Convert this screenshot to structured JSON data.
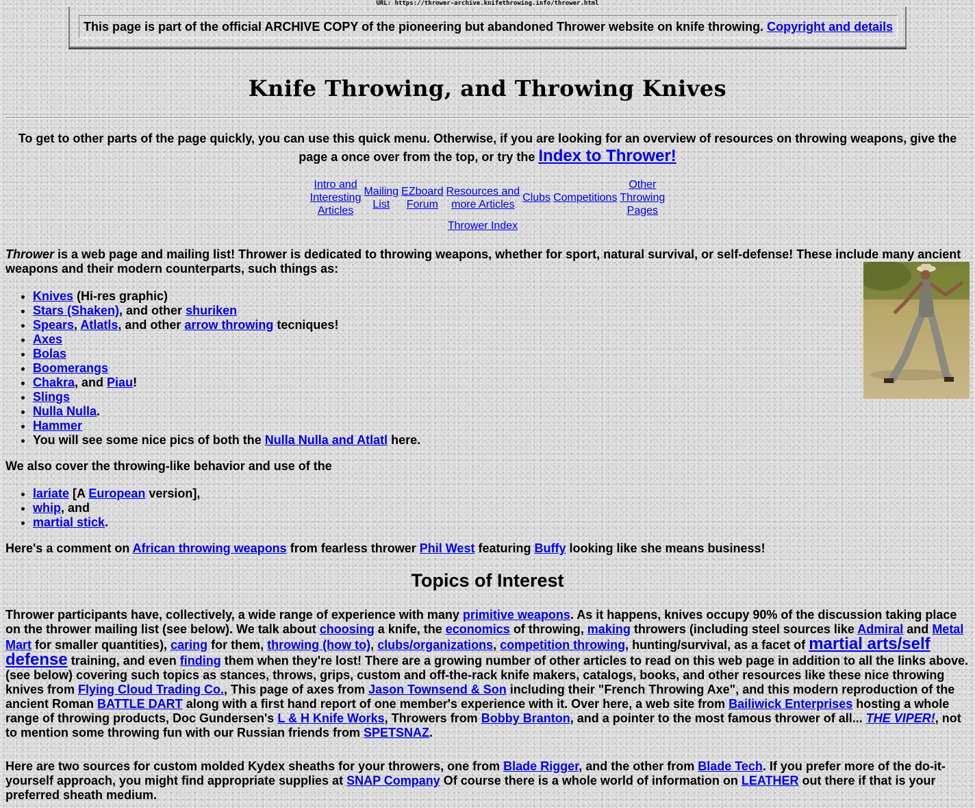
{
  "url_line": "URL: https://thrower-archive.knifethrowing.info/thrower.html",
  "archive": {
    "text": "This page is part of the official ARCHIVE COPY of the pioneering but abandoned Thrower website on knife throwing.",
    "link": "Copyright and details"
  },
  "title": "Knife Throwing, and Throwing Knives",
  "intro": {
    "text": "To get to other parts of the page quickly, you can use this quick menu. Otherwise, if you are looking for an overview of resources on throwing weapons, give the page a once over from the top, or try the",
    "index_link": "Index to Thrower!"
  },
  "quick_menu": {
    "intro_l1": "Intro and",
    "intro_l2": "Interesting",
    "intro_l3": "Articles",
    "mailing_l1": "Mailing",
    "mailing_l2": "List",
    "ezboard_l1": "EZboard",
    "ezboard_l2": "Forum",
    "resources_l1": "Resources and",
    "resources_l2": "more Articles",
    "clubs": "Clubs",
    "competitions": "Competitions",
    "other_l1": "Other",
    "other_l2": "Throwing",
    "other_l3": "Pages",
    "index": "Thrower Index"
  },
  "para1": {
    "em": "Thrower",
    "text": " is a web page and mailing list! Thrower is dedicated to throwing weapons, whether for sport, natural survival, or self-defense! These include many ancient weapons and their modern counterparts, such things as:"
  },
  "list1": {
    "knives": "Knives",
    "knives_note": " (Hi-res graphic)",
    "stars": "Stars (Shaken)",
    "and_other": ", and other ",
    "shuriken": "shuriken",
    "spears": "Spears",
    "comma": ", ",
    "atlatls": "Atlatls",
    "arrow": "arrow throwing",
    "tecniques": " tecniques!",
    "axes": "Axes",
    "bolas": "Bolas",
    "boomerangs": "Boomerangs",
    "chakra": "Chakra",
    "and": ", and ",
    "piau": "Piau",
    "bang": "!",
    "slings": "Slings",
    "nulla": "Nulla Nulla",
    "period": ".",
    "hammer": "Hammer",
    "pics_a": "You will see some nice pics of both the ",
    "pics_link": "Nulla Nulla and Atlatl",
    "pics_b": " here."
  },
  "para2": "We also cover the throwing-like behavior and use of the",
  "list2": {
    "lariate": "lariate",
    "bracket_a": " [A ",
    "european": "European",
    "bracket_b": " version],",
    "whip": "whip",
    "and": ", and",
    "martial": "martial stick",
    "period": "."
  },
  "para3": {
    "a": "Here's a comment on ",
    "african": "African throwing weapons",
    "b": " from fearless thrower ",
    "phil": "Phil West",
    "c": " featuring ",
    "buffy": "Buffy",
    "d": " looking like she means business!"
  },
  "topics_heading": "Topics of Interest",
  "para4": {
    "t1": "Thrower participants have, collectively, a wide range of experience with many ",
    "l1": "primitive weapons",
    "t2": ". As it happens, knives occupy 90% of the discussion taking place on the thrower mailing list (see below). We talk about ",
    "l2": "choosing",
    "t3": " a knife, the ",
    "l3": "economics",
    "t4": " of throwing, ",
    "l4": "making",
    "t5": " throwers (including steel sources like ",
    "l5": "Admiral",
    "t6": " and ",
    "l6": "Metal Mart",
    "t7": " for smaller quantities), ",
    "l7": "caring",
    "t8": " for them, ",
    "l8": "throwing (how to)",
    "t9": ", ",
    "l9": "clubs/organizations",
    "t10": ", ",
    "l10": "competition throwing",
    "t11": ", hunting/survival, as a facet of ",
    "l11": "martial arts/self defense",
    "t12": " training, and even ",
    "l12": "finding",
    "t13": " them when they're lost! There are a growing number of other articles to read on this web page in addition to all the links above. (see below) covering such topics as stances, throws, grips, custom and off-the-rack knife makers, catalogs, books, and other resources like these nice throwing knives from ",
    "l13": "Flying Cloud Trading Co.",
    "t14": ", This page of axes from ",
    "l14": "Jason Townsend & Son",
    "t15": " including their \"French Throwing Axe\", and this modern reproduction of the ancient Roman ",
    "l15": "BATTLE DART",
    "t16": " along with a first hand report of one member's experience with it. Over here, a web site from ",
    "l16": "Bailiwick Enterprises",
    "t17": " hosting a whole range of throwing products, Doc Gundersen's ",
    "l17": "L & H Knife Works",
    "t18": ", Throwers from ",
    "l18": "Bobby Branton",
    "t19": ", and a pointer to the most famous thrower of all... ",
    "l19": "THE VIPER!",
    "t20": ", not to mention some throwing fun with our Russian friends from ",
    "l20": "SPETSNAZ",
    "t21": "."
  },
  "para5": {
    "t1": "Here are two sources for custom molded Kydex sheaths for your throwers, one from ",
    "l1": "Blade Rigger",
    "t2": ", and the other from ",
    "l2": "Blade Tech",
    "t3": ". If you prefer more of the do-it-yourself approach, you might find appropriate supplies at ",
    "l3": "SNAP Company",
    "t4": " Of course there is a whole world of information on ",
    "l4": "LEATHER",
    "t5": " out there if that is your preferred sheath medium."
  }
}
